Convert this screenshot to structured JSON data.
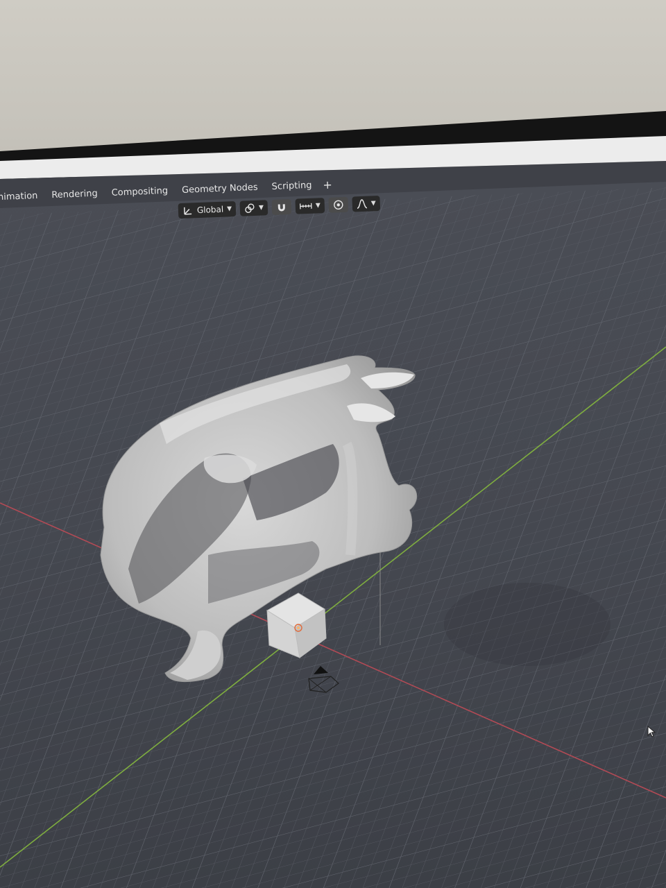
{
  "workspace_tabs": [
    {
      "label": "nimation"
    },
    {
      "label": "Rendering"
    },
    {
      "label": "Compositing"
    },
    {
      "label": "Geometry Nodes"
    },
    {
      "label": "Scripting"
    }
  ],
  "add_tab_label": "+",
  "toolbar": {
    "transform_orientation": "Global",
    "pivot_icon": "transform-pivot-icon",
    "snap_icon": "magnet-snap-icon",
    "snap_target_icon": "snap-increment-icon",
    "proportional_icon": "proportional-edit-icon",
    "falloff_icon": "falloff-curve-icon"
  },
  "viewport": {
    "background": "#3d4048",
    "x_axis_color": "#b34a55",
    "y_axis_color": "#7fae3f",
    "objects": [
      "scanned-mesh",
      "default-cube",
      "camera",
      "light"
    ]
  }
}
